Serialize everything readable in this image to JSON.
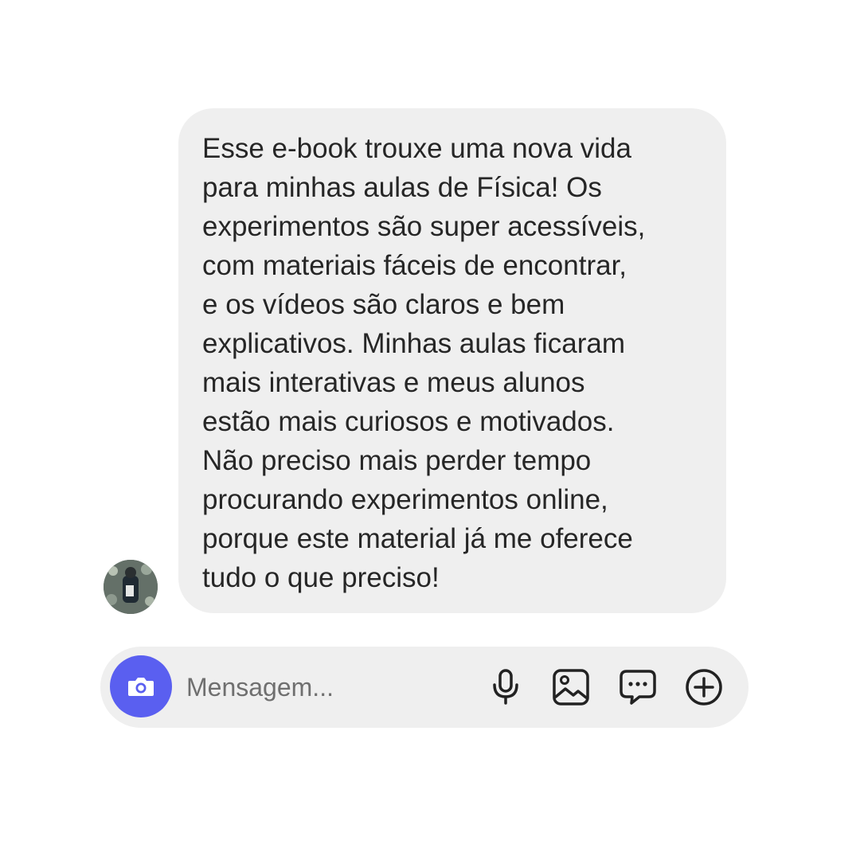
{
  "conversation": {
    "message": {
      "lines": [
        "Esse e-book trouxe uma nova vida",
        "para minhas aulas de Física! Os",
        "experimentos são super acessíveis,",
        "com materiais fáceis de encontrar,",
        "e os vídeos são claros e bem",
        "explicativos. Minhas aulas ficaram",
        "mais interativas e meus alunos",
        "estão mais curiosos e motivados.",
        "Não preciso mais perder tempo",
        "procurando experimentos online,",
        "porque este material já me oferece",
        "tudo o que preciso!"
      ]
    },
    "sender": {
      "avatar_icon": "avatar"
    }
  },
  "composer": {
    "placeholder": "Mensagem...",
    "camera_icon": "camera-icon",
    "actions": [
      "microphone-icon",
      "image-icon",
      "chat-bubble-icon",
      "plus-circle-icon"
    ],
    "accent_color": "#5a5ff0",
    "surface_color": "#efefef"
  }
}
